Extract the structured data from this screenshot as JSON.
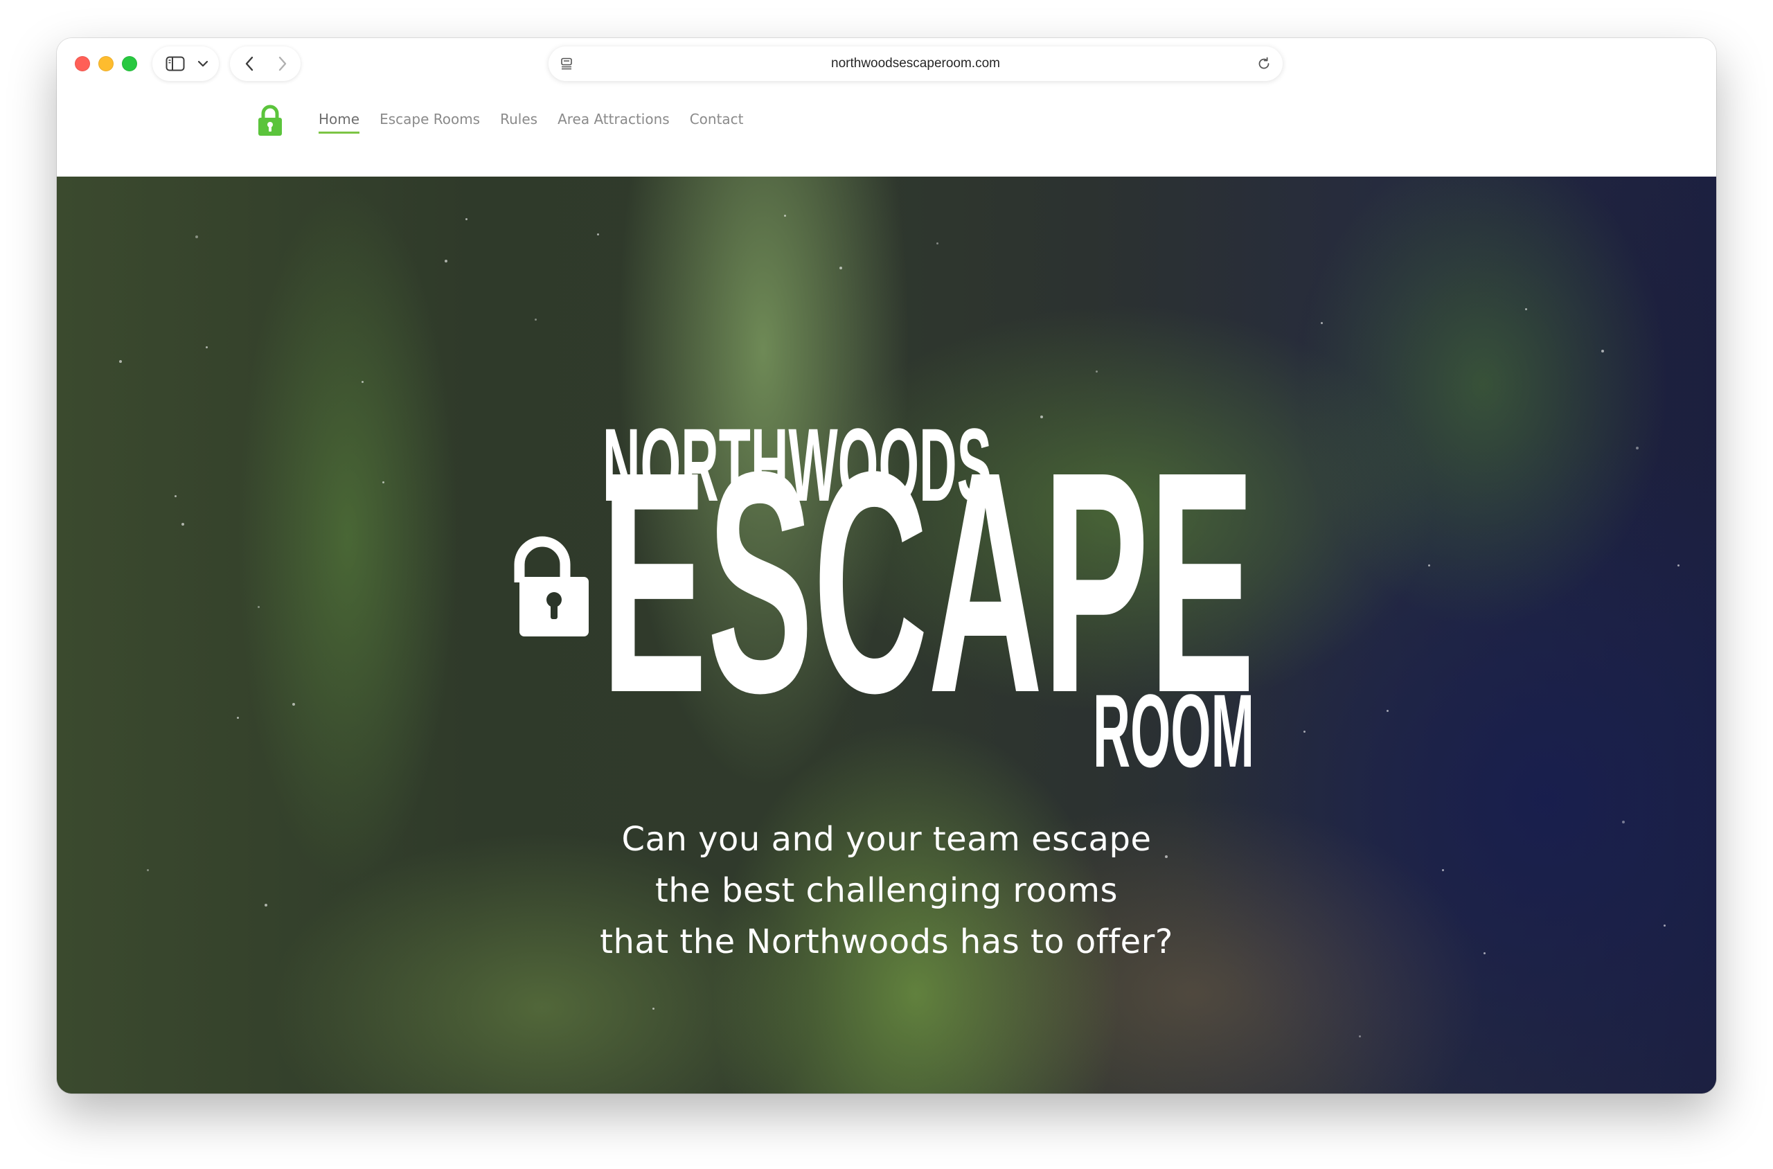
{
  "browser": {
    "url": "northwoodsescaperoom.com",
    "icons": {
      "close": "red-traffic-light",
      "minimize": "yellow-traffic-light",
      "maximize": "green-traffic-light",
      "sidebar": "sidebar-icon",
      "sidebar_menu": "chevron-down-icon",
      "back": "chevron-left-icon",
      "forward": "chevron-right-icon",
      "page_menu": "page-settings-icon",
      "reload": "reload-icon"
    }
  },
  "site": {
    "logo_icon": "padlock-icon",
    "nav": [
      {
        "label": "Home"
      },
      {
        "label": "Escape Rooms"
      },
      {
        "label": "Rules"
      },
      {
        "label": "Area Attractions"
      },
      {
        "label": "Contact"
      }
    ],
    "active_nav": "Home"
  },
  "hero": {
    "logo_line1": "NORTHWOODS",
    "logo_line2": "ESCAPE",
    "logo_line3": "ROOM",
    "logo_icon": "padlock-icon",
    "tagline": [
      "Can you and your team escape",
      "the best challenging rooms",
      "that the Northwoods has to offer?"
    ]
  },
  "colors": {
    "accent_green": "#5bc43c",
    "nav_underline": "#7cc444",
    "nav_text": "#8a8a8a",
    "hero_text": "#ffffff"
  }
}
